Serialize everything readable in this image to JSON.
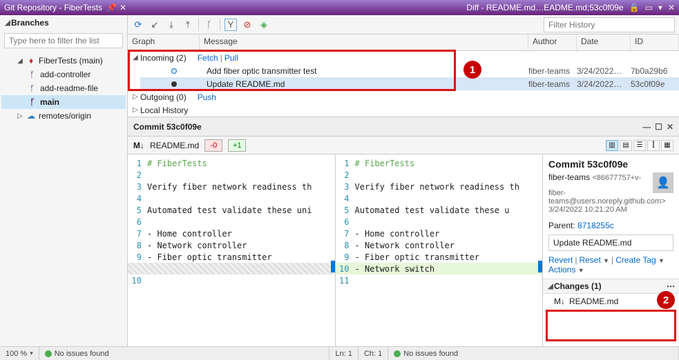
{
  "titlebar": {
    "left": "Git Repository - FiberTests",
    "right": "Diff - README.md…EADME.md;53c0f09e"
  },
  "sidebar": {
    "header": "Branches",
    "filter_placeholder": "Type here to filter the list",
    "repo": "FiberTests (main)",
    "branches": [
      "add-controller",
      "add-readme-file",
      "main"
    ],
    "remotes": "remotes/origin"
  },
  "history": {
    "filter_placeholder": "Filter History",
    "headers": {
      "graph": "Graph",
      "message": "Message",
      "author": "Author",
      "date": "Date",
      "id": "ID"
    },
    "groups": {
      "incoming": {
        "label": "Incoming (2)",
        "links": [
          "Fetch",
          "Pull"
        ]
      },
      "outgoing": {
        "label": "Outgoing (0)",
        "links": [
          "Push"
        ]
      },
      "local": {
        "label": "Local History"
      }
    },
    "incoming_rows": [
      {
        "msg": "Add fiber optic transmitter test",
        "author": "fiber-teams",
        "date": "3/24/2022…",
        "id": "7b0a29b6"
      },
      {
        "msg": "Update README.md",
        "author": "fiber-teams",
        "date": "3/24/2022…",
        "id": "53c0f09e"
      }
    ]
  },
  "commit": {
    "title": "Commit 53c0f09e",
    "file": "README.md",
    "badge_removed": "-0",
    "badge_added": "+1",
    "details": {
      "title": "Commit 53c0f09e",
      "author": "fiber-teams",
      "author_suffix": "<86677757+v-",
      "email": "fiber-teams@users.noreply.github.com>",
      "timestamp": "3/24/2022 10:21:20 AM",
      "parent_label": "Parent:",
      "parent_sha": "8718255c",
      "message": "Update README.md",
      "actions": {
        "revert": "Revert",
        "reset": "Reset",
        "create_tag": "Create Tag",
        "more": "Actions"
      },
      "changes_header": "Changes (1)",
      "changed_file": "README.md",
      "changed_status": "M"
    },
    "left_lines": [
      {
        "n": "1",
        "t": "# FiberTests",
        "cls": "comment-c"
      },
      {
        "n": "2",
        "t": ""
      },
      {
        "n": "3",
        "t": "Verify fiber network readiness th"
      },
      {
        "n": "4",
        "t": ""
      },
      {
        "n": "5",
        "t": "Automated test validate these uni"
      },
      {
        "n": "6",
        "t": ""
      },
      {
        "n": "7",
        "t": "- Home controller"
      },
      {
        "n": "8",
        "t": "- Network controller"
      },
      {
        "n": "9",
        "t": "- Fiber optic transmitter"
      },
      {
        "n": "",
        "t": "",
        "hatch": true
      },
      {
        "n": "10",
        "t": ""
      }
    ],
    "right_lines": [
      {
        "n": "1",
        "t": "# FiberTests",
        "cls": "comment-c"
      },
      {
        "n": "2",
        "t": ""
      },
      {
        "n": "3",
        "t": "Verify fiber network readiness th"
      },
      {
        "n": "4",
        "t": ""
      },
      {
        "n": "5",
        "t": "Automated test validate these u"
      },
      {
        "n": "6",
        "t": ""
      },
      {
        "n": "7",
        "t": "- Home controller"
      },
      {
        "n": "8",
        "t": "- Network controller"
      },
      {
        "n": "9",
        "t": "- Fiber optic transmitter"
      },
      {
        "n": "10",
        "t": "- Network switch",
        "add": true
      },
      {
        "n": "11",
        "t": ""
      }
    ]
  },
  "statusbar": {
    "zoom": "100 %",
    "issues": "No issues found",
    "ln": "Ln: 1",
    "ch": "Ch: 1",
    "issues2": "No issues found"
  },
  "callouts": {
    "one": "1",
    "two": "2"
  }
}
